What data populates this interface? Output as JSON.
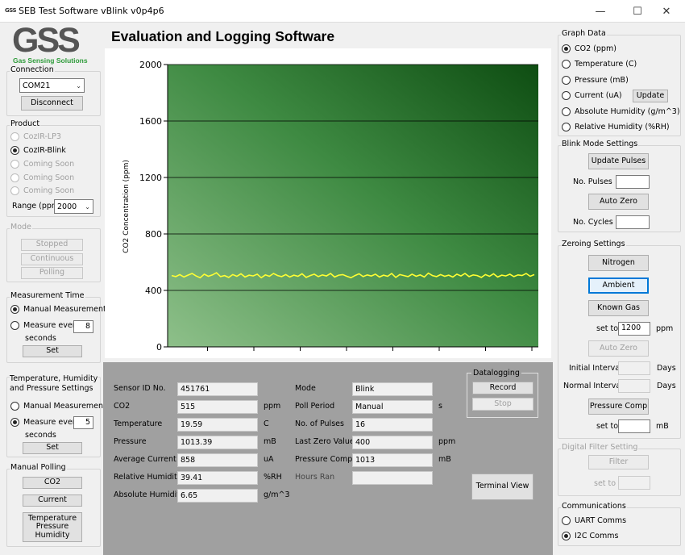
{
  "window": {
    "title": "SEB Test Software vBlink v0p4p6",
    "logo_small": "GSS",
    "minimize": "—",
    "maximize": "☐",
    "close": "✕"
  },
  "logo": {
    "letters": "GSS",
    "subtitle": "Gas Sensing Solutions"
  },
  "heading": "Evaluation and Logging Software",
  "connection": {
    "title": "Connection",
    "port": "COM21",
    "disconnect": "Disconnect"
  },
  "product": {
    "title": "Product",
    "options": [
      "CozIR-LP3",
      "CozIR-Blink",
      "Coming Soon",
      "Coming Soon",
      "Coming Soon"
    ],
    "selected": "CozIR-Blink",
    "range_label": "Range (ppm)",
    "range_value": "2000"
  },
  "mode": {
    "title": "Mode",
    "stopped": "Stopped",
    "continuous": "Continuous",
    "polling": "Polling"
  },
  "measurement_time": {
    "title": "Measurement Time",
    "manual": "Manual Measurement",
    "every": "Measure every",
    "every_value": "8",
    "seconds": "seconds",
    "set": "Set"
  },
  "thp_settings": {
    "title": "Temperature, Humidity and Pressure Settings",
    "manual": "Manual Measurement",
    "every": "Measure every",
    "every_value": "5",
    "seconds": "seconds",
    "set": "Set"
  },
  "manual_polling": {
    "title": "Manual Polling",
    "co2": "CO2",
    "current": "Current",
    "tph": "Temperature Pressure Humidity"
  },
  "graph_data": {
    "title": "Graph Data",
    "options": [
      "CO2 (ppm)",
      "Temperature (C)",
      "Pressure (mB)",
      "Current (uA)",
      "Absolute Humidity (g/m^3)",
      "Relative Humidity (%RH)"
    ],
    "selected": "CO2 (ppm)",
    "update": "Update"
  },
  "blink_mode": {
    "title": "Blink Mode Settings",
    "update_pulses": "Update Pulses",
    "no_pulses": "No. Pulses",
    "auto_zero": "Auto Zero",
    "no_cycles": "No. Cycles"
  },
  "zeroing": {
    "title": "Zeroing Settings",
    "nitrogen": "Nitrogen",
    "ambient": "Ambient",
    "known_gas": "Known Gas",
    "set_to": "set to",
    "set_value": "1200",
    "ppm": "ppm",
    "auto_zero": "Auto Zero",
    "initial_interval": "Initial Interval",
    "normal_interval": "Normal Interval",
    "days": "Days",
    "pressure_comp": "Pressure Comp",
    "mb": "mB"
  },
  "digital_filter": {
    "title": "Digital Filter Setting",
    "filter": "Filter",
    "set_to": "set to"
  },
  "communications": {
    "title": "Communications",
    "uart": "UART Comms",
    "i2c": "I2C Comms",
    "selected": "I2C Comms"
  },
  "readings": {
    "sensor_id": {
      "label": "Sensor ID No.",
      "value": "451761"
    },
    "co2": {
      "label": "CO2",
      "value": "515",
      "unit": "ppm"
    },
    "temperature": {
      "label": "Temperature",
      "value": "19.59",
      "unit": "C"
    },
    "pressure": {
      "label": "Pressure",
      "value": "1013.39",
      "unit": "mB"
    },
    "avg_current": {
      "label": "Average Current",
      "value": "858",
      "unit": "uA"
    },
    "rel_humidity": {
      "label": "Relative Humidity",
      "value": "39.41",
      "unit": "%RH"
    },
    "abs_humidity": {
      "label": "Absolute Humidity",
      "value": "6.65",
      "unit": "g/m^3"
    },
    "mode": {
      "label": "Mode",
      "value": "Blink"
    },
    "poll_period": {
      "label": "Poll Period",
      "value": "Manual",
      "unit": "s"
    },
    "no_pulses": {
      "label": "No. of Pulses",
      "value": "16"
    },
    "last_zero": {
      "label": "Last Zero Value",
      "value": "400",
      "unit": "ppm"
    },
    "pressure_comp": {
      "label": "Pressure Comp",
      "value": "1013",
      "unit": "mB"
    },
    "hours_ran": {
      "label": "Hours Ran",
      "value": ""
    }
  },
  "datalogging": {
    "title": "Datalogging",
    "record": "Record",
    "stop": "Stop"
  },
  "terminal_view": "Terminal View",
  "colors": {
    "plot_dark": "#0e4d12",
    "plot_light": "#8ec08a",
    "series": "#ffff33"
  },
  "chart_data": {
    "type": "line",
    "ylabel": "CO2 Concentration (ppm)",
    "ylim": [
      0,
      2000
    ],
    "yticks": [
      0,
      400,
      800,
      1200,
      1600,
      2000
    ],
    "grid": true,
    "series": [
      {
        "values": [
          505,
          498,
          512,
          495,
          508,
          520,
          502,
          490,
          515,
          500,
          510,
          525,
          498,
          505,
          492,
          512,
          500,
          518,
          495,
          508,
          502,
          515,
          490,
          510,
          500,
          520,
          505,
          498,
          512,
          495,
          508,
          500,
          518,
          492,
          505,
          515,
          498,
          510,
          502,
          520,
          495,
          508,
          512,
          500,
          490,
          505,
          518,
          498,
          510,
          502,
          515,
          495,
          508,
          500,
          520,
          492,
          512,
          505,
          498,
          515,
          500,
          510,
          495,
          522,
          505,
          498,
          512,
          500,
          508,
          495,
          515,
          502,
          520,
          498,
          510,
          505,
          492,
          512,
          500,
          518,
          495,
          508,
          502,
          515,
          498,
          510,
          505,
          520,
          500,
          512
        ]
      }
    ]
  }
}
